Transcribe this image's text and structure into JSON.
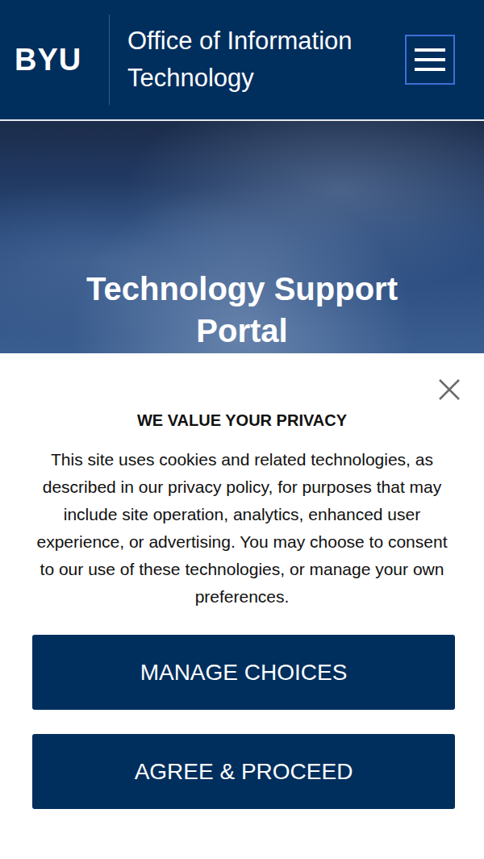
{
  "header": {
    "logo": "BYU",
    "title": "Office of Information Technology"
  },
  "hero": {
    "title": "Technology Support Portal"
  },
  "consent": {
    "heading": "WE VALUE YOUR PRIVACY",
    "body": "This site uses cookies and related technologies, as described in our privacy policy, for purposes that may include site operation, analytics, enhanced user experience, or advertising. You may choose to consent to our use of these technologies, or manage your own preferences.",
    "buttons": [
      "MANAGE CHOICES",
      "AGREE & PROCEED"
    ]
  }
}
